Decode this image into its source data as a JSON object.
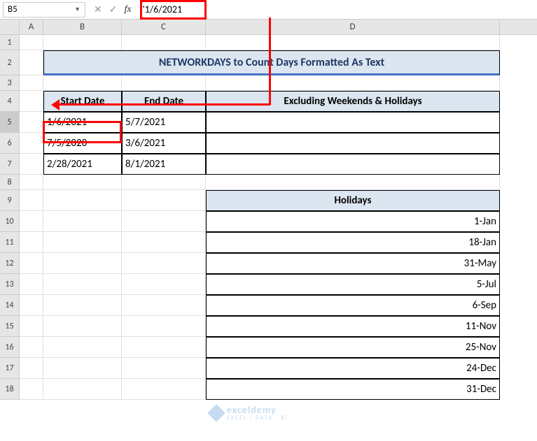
{
  "namebox": "B5",
  "formula": "'1/6/2021",
  "columns": [
    "A",
    "B",
    "C",
    "D"
  ],
  "rows": [
    "1",
    "2",
    "3",
    "4",
    "5",
    "6",
    "7",
    "8",
    "9",
    "10",
    "11",
    "12",
    "13",
    "14",
    "15",
    "16",
    "17",
    "18"
  ],
  "title": "NETWORKDAYS to Count Days Formatted As Text",
  "headers": {
    "b": "Start Date",
    "c": "End Date",
    "d": "Excluding Weekends & Holidays"
  },
  "data": {
    "r5": {
      "b": "1/6/2021",
      "c": "5/7/2021",
      "d": ""
    },
    "r6": {
      "b": "7/5/2020",
      "c": "3/6/2021",
      "d": ""
    },
    "r7": {
      "b": "2/28/2021",
      "c": "8/1/2021",
      "d": ""
    }
  },
  "holidays_header": "Holidays",
  "holidays": [
    "1-Jan",
    "18-Jan",
    "31-May",
    "5-Jul",
    "6-Sep",
    "11-Nov",
    "25-Nov",
    "24-Dec",
    "31-Dec"
  ],
  "watermark": {
    "name": "exceldemy",
    "tag": "EXCEL · DATA · BI"
  }
}
